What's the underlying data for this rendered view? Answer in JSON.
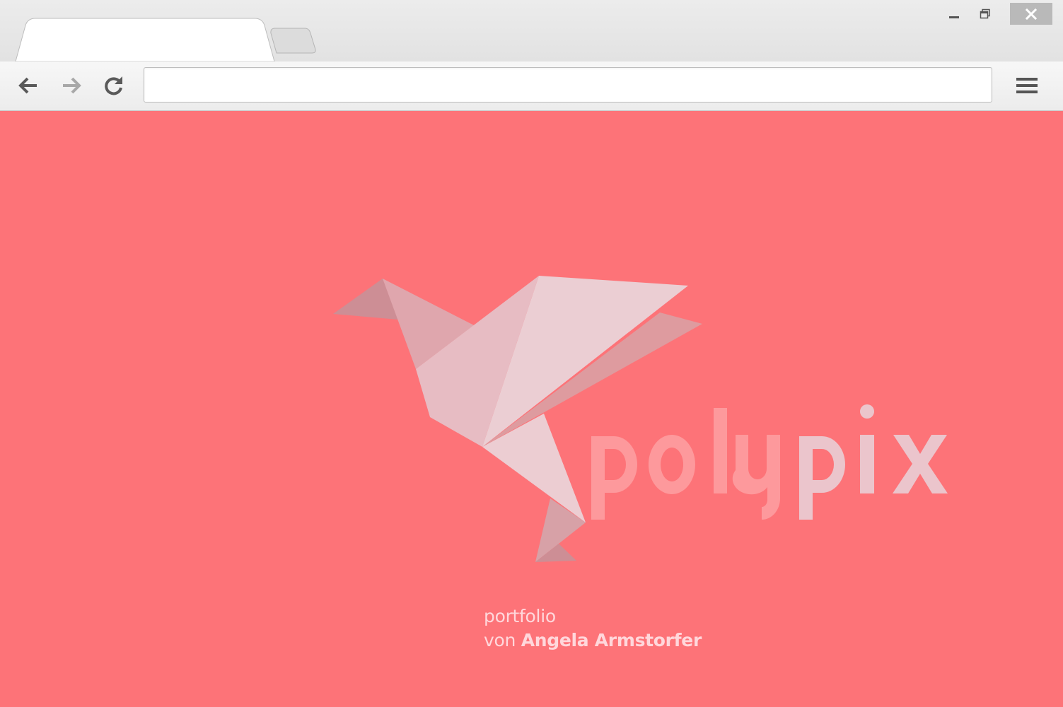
{
  "browser": {
    "tab": {
      "title": ""
    },
    "address_bar": {
      "value": "",
      "placeholder": ""
    },
    "window_controls": [
      "minimize",
      "restore",
      "close"
    ],
    "nav_icons": [
      "back-icon",
      "forward-icon",
      "reload-icon",
      "menu-icon"
    ]
  },
  "page": {
    "background_color": "#fd7378",
    "logo": {
      "wordmark": "polypix",
      "icon": "origami-bird"
    },
    "tagline": {
      "line1": "portfolio",
      "prefix": "von",
      "author": "Angela Armstorfer"
    }
  },
  "colors": {
    "chrome_bg": "#e6e6e6",
    "close_button": "#b9b9b9",
    "page_bg": "#fd7378",
    "logo_light": "#e9c3c9",
    "logo_dark": "#cd8e95"
  }
}
